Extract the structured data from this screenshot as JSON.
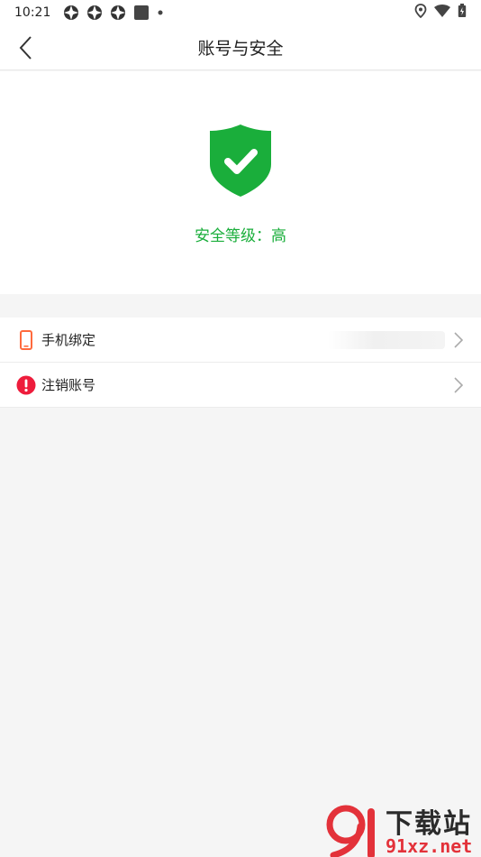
{
  "status_bar": {
    "time": "10:21",
    "left_icons": [
      "app-notification-icon",
      "app-notification-icon",
      "app-notification-icon",
      "square-notification-icon",
      "dot-icon"
    ],
    "right_icons": [
      "location-icon",
      "wifi-icon",
      "battery-icon"
    ]
  },
  "header": {
    "title": "账号与安全",
    "back_icon": "chevron-left-icon"
  },
  "hero": {
    "shield_icon": "shield-check-icon",
    "level_text": "安全等级：高",
    "accent_color": "#1aae3b"
  },
  "list": {
    "items": [
      {
        "label": "手机绑定",
        "icon": "phone-icon",
        "icon_color": "#ff6a3d"
      },
      {
        "label": "注销账号",
        "icon": "alert-icon",
        "icon_color": "#ee1c3c"
      }
    ]
  },
  "watermark": {
    "top": "下载站",
    "bottom": "91xz.net"
  }
}
